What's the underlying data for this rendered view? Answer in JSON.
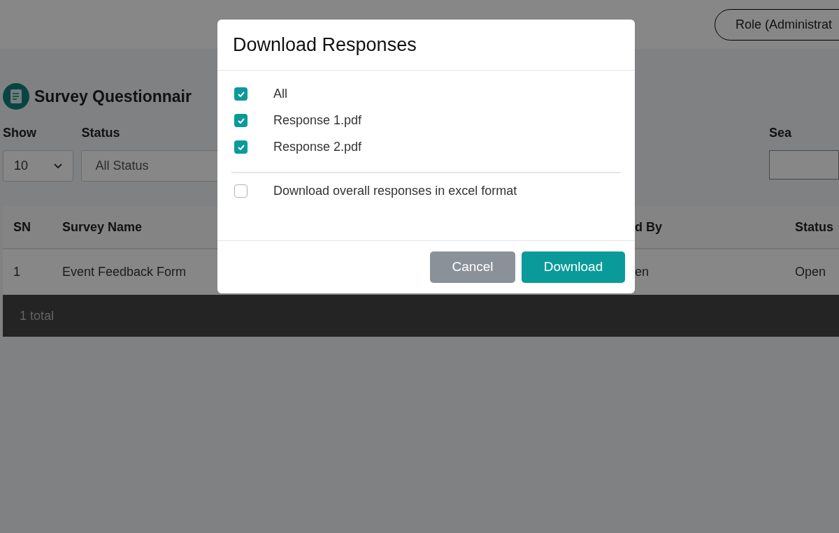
{
  "header": {
    "role_button": "Role (Administrat"
  },
  "page": {
    "title": "Survey Questionnair",
    "filters": [
      {
        "label": "Show",
        "value": "10",
        "kind": "select"
      },
      {
        "label": "Status",
        "value": "All Status",
        "kind": "field"
      }
    ],
    "search": {
      "label": "Sea"
    }
  },
  "table": {
    "columns": [
      "SN",
      "Survey Name",
      "d By",
      "Status"
    ],
    "rows": [
      [
        "1",
        "Event Feedback Form",
        "en",
        "Open"
      ]
    ],
    "footer": "1 total"
  },
  "dialog": {
    "title": "Download Responses",
    "options": [
      {
        "label": "All",
        "checked": true
      },
      {
        "label": "Response 1.pdf",
        "checked": true
      },
      {
        "label": "Response 2.pdf",
        "checked": true
      }
    ],
    "excel_option": {
      "label": "Download overall responses in excel format",
      "checked": false
    },
    "buttons": [
      {
        "label": "Cancel",
        "kind": "secondary"
      },
      {
        "label": "Download",
        "kind": "primary"
      }
    ]
  }
}
